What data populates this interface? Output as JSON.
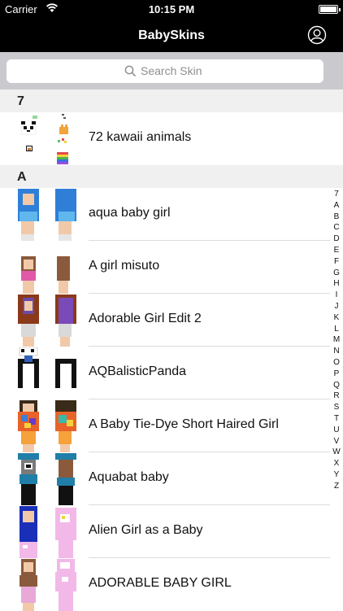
{
  "status": {
    "carrier": "Carrier",
    "time": "10:15 PM"
  },
  "nav": {
    "title": "BabySkins"
  },
  "search": {
    "placeholder": "Search Skin"
  },
  "sections": [
    {
      "header": "7",
      "items": [
        {
          "label": "72 kawaii animals"
        }
      ]
    },
    {
      "header": "A",
      "items": [
        {
          "label": "aqua baby girl"
        },
        {
          "label": "A girl misuto"
        },
        {
          "label": "Adorable Girl Edit 2"
        },
        {
          "label": "AQBalisticPanda"
        },
        {
          "label": "A Baby Tie-Dye Short Haired Girl"
        },
        {
          "label": "Aquabat baby"
        },
        {
          "label": "Alien Girl as a Baby"
        },
        {
          "label": "ADORABLE BABY GIRL"
        }
      ]
    }
  ],
  "index": [
    "7",
    "A",
    "B",
    "C",
    "D",
    "E",
    "F",
    "G",
    "H",
    "I",
    "J",
    "K",
    "L",
    "M",
    "N",
    "O",
    "P",
    "Q",
    "R",
    "S",
    "T",
    "U",
    "V",
    "W",
    "X",
    "Y",
    "Z"
  ],
  "colors": {
    "bar": "#000000",
    "search_bg": "#c9c9ce",
    "section_bg": "#f0f0f0"
  }
}
